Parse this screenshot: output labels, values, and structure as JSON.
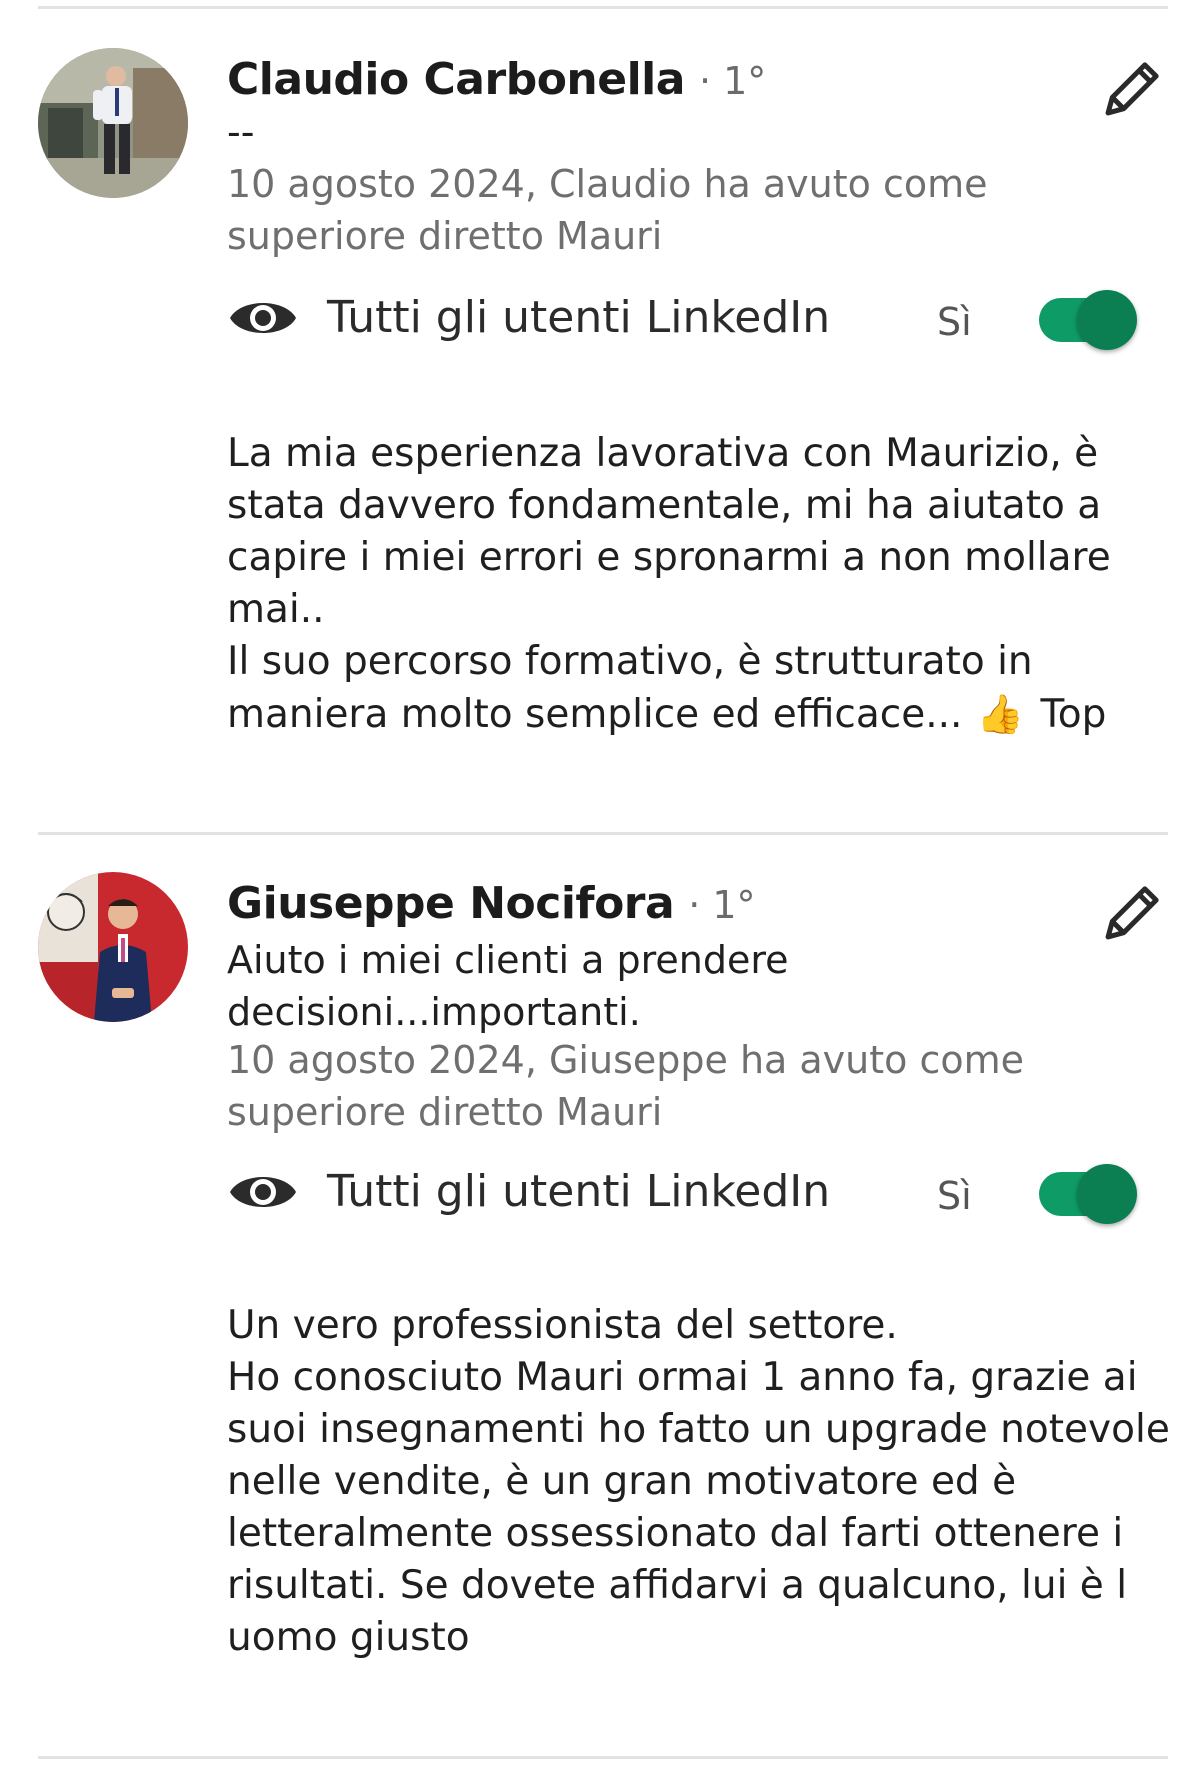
{
  "recommendations": [
    {
      "name": "Claudio Carbonella",
      "degree": "· 1°",
      "headline_lines": [
        "--"
      ],
      "meta_lines": [
        "10 agosto 2024, Claudio ha avuto come",
        "superiore diretto Mauri"
      ],
      "visibility_label": "Tutti gli utenti LinkedIn",
      "visibility_value": "Sì",
      "toggle_on": true,
      "body_lines": [
        "La mia esperienza lavorativa con Maurizio, è",
        "stata davvero fondamentale, mi ha aiutato a",
        "capire i miei errori e spronarmi a non mollare",
        "mai..",
        "Il suo percorso formativo, è strutturato in"
      ],
      "body_last_before_emoji": "maniera molto semplice ed efficace...",
      "emoji": "👍",
      "body_last_after_emoji": "Top",
      "icons": {
        "edit": "pencil-icon",
        "visibility": "eye-icon"
      }
    },
    {
      "name": "Giuseppe Nocifora",
      "degree": "· 1°",
      "headline_lines": [
        "Aiuto i miei clienti a prendere",
        "decisioni...importanti."
      ],
      "meta_lines": [
        "10 agosto 2024, Giuseppe ha avuto come",
        "superiore diretto Mauri"
      ],
      "visibility_label": "Tutti gli utenti LinkedIn",
      "visibility_value": "Sì",
      "toggle_on": true,
      "body_lines": [
        "Un vero professionista del settore.",
        "Ho conosciuto Mauri ormai 1 anno fa, grazie ai",
        "suoi insegnamenti ho fatto un upgrade notevole",
        "nelle vendite, è un gran motivatore ed è",
        "letteralmente ossessionato dal farti ottenere i",
        "risultati. Se dovete affidarvi a qualcuno, lui è l",
        "uomo giusto"
      ],
      "icons": {
        "edit": "pencil-icon",
        "visibility": "eye-icon"
      }
    }
  ],
  "colors": {
    "toggle_track": "#0f9b66",
    "toggle_knob": "#0b7f52",
    "meta_text": "#6f6f6f",
    "divider": "#e3e3e3"
  }
}
